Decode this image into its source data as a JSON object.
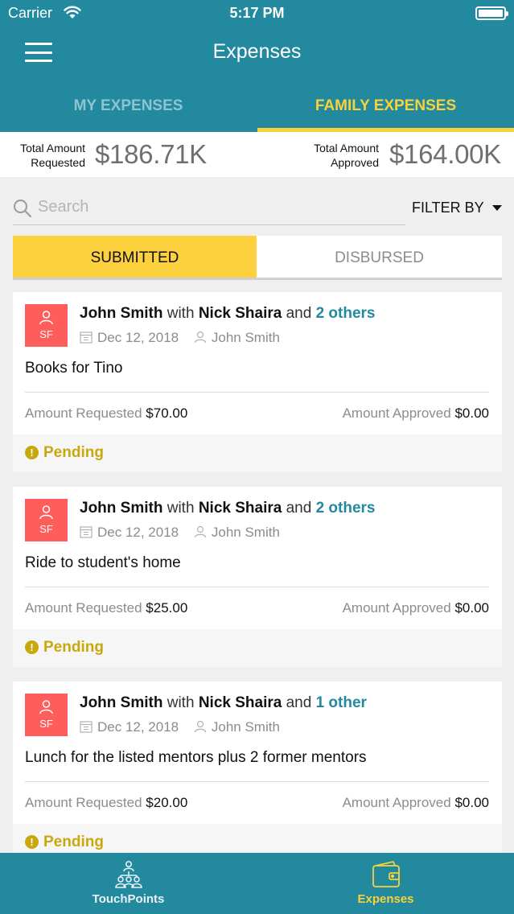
{
  "status_bar": {
    "carrier": "Carrier",
    "time": "5:17 PM"
  },
  "nav": {
    "title": "Expenses"
  },
  "tabs": [
    {
      "label": "MY EXPENSES",
      "active": false
    },
    {
      "label": "FAMILY EXPENSES",
      "active": true
    }
  ],
  "totals": {
    "requested_label_1": "Total Amount",
    "requested_label_2": "Requested",
    "requested_value": "$186.71K",
    "approved_label_1": "Total Amount",
    "approved_label_2": "Approved",
    "approved_value": "$164.00K"
  },
  "search": {
    "placeholder": "Search"
  },
  "filter": {
    "label": "FILTER BY"
  },
  "segments": [
    {
      "label": "SUBMITTED",
      "active": true
    },
    {
      "label": "DISBURSED",
      "active": false
    }
  ],
  "expenses": [
    {
      "initials": "SF",
      "submitter": "John Smith",
      "with_word": "with",
      "partner": "Nick Shaira",
      "and_word": "and",
      "others": "2 others",
      "date": "Dec 12, 2018",
      "owner": "John Smith",
      "description": "Books for Tino",
      "requested_label": "Amount Requested",
      "requested": "$70.00",
      "approved_label": "Amount Approved",
      "approved": "$0.00",
      "status": "Pending"
    },
    {
      "initials": "SF",
      "submitter": "John Smith",
      "with_word": "with",
      "partner": "Nick Shaira",
      "and_word": "and",
      "others": "2 others",
      "date": "Dec 12, 2018",
      "owner": "John Smith",
      "description": "Ride to student's home",
      "requested_label": "Amount Requested",
      "requested": "$25.00",
      "approved_label": "Amount Approved",
      "approved": "$0.00",
      "status": "Pending"
    },
    {
      "initials": "SF",
      "submitter": "John Smith",
      "with_word": "with",
      "partner": "Nick Shaira",
      "and_word": "and",
      "others": "1 other",
      "date": "Dec 12, 2018",
      "owner": "John Smith",
      "description": "Lunch for the listed mentors plus 2 former mentors",
      "requested_label": "Amount Requested",
      "requested": "$20.00",
      "approved_label": "Amount Approved",
      "approved": "$0.00",
      "status": "Pending"
    }
  ],
  "tabbar": [
    {
      "label": "TouchPoints",
      "icon": "people-network-icon",
      "active": false
    },
    {
      "label": "Expenses",
      "icon": "wallet-icon",
      "active": true
    }
  ],
  "colors": {
    "primary": "#23899e",
    "accent": "#fdd13d",
    "avatar": "#ff5c5c",
    "pending": "#c9a80e"
  }
}
